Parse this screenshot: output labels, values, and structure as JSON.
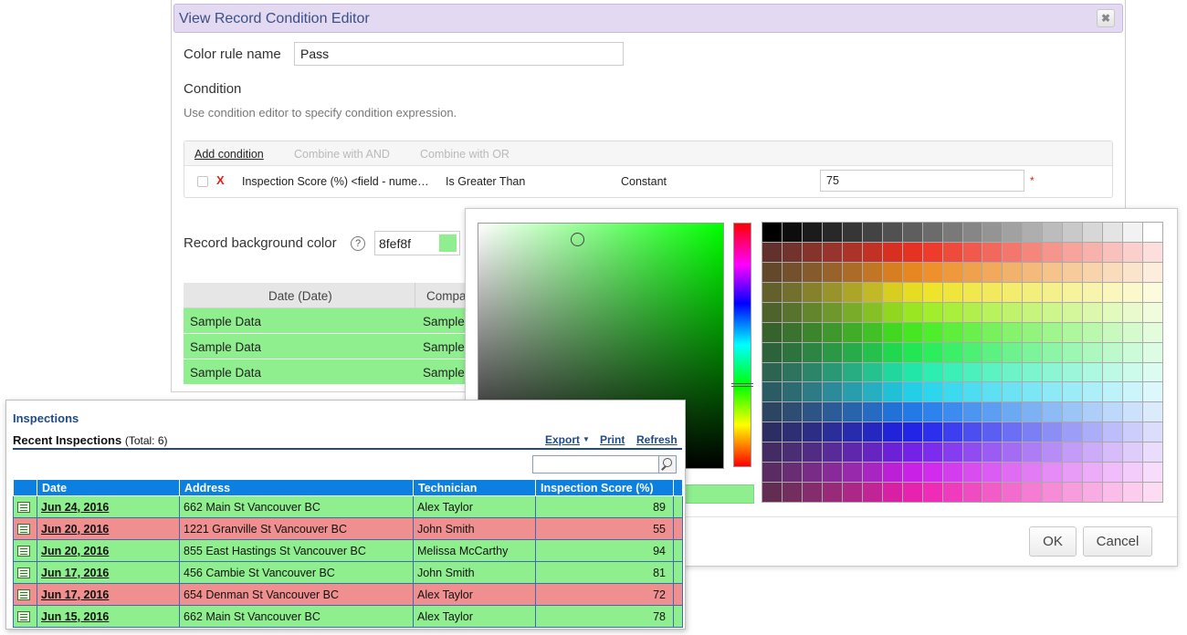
{
  "editor": {
    "title": "View Record Condition Editor",
    "close_label": "✖",
    "rule_name_label": "Color rule name",
    "rule_name_value": "Pass",
    "condition_heading": "Condition",
    "condition_help": "Use condition editor to specify condition expression.",
    "toolbar": {
      "add_condition": "Add condition",
      "combine_and": "Combine with AND",
      "combine_or": "Combine with OR"
    },
    "condition_row": {
      "delete_label": "X",
      "field": "Inspection Score (%) <field - nume…",
      "operator": "Is Greater Than",
      "value_type": "Constant",
      "value": "75",
      "required_mark": "*"
    },
    "background_label": "Record background color",
    "help_label": "?",
    "background_value": "8fef8f",
    "background_color": "#8fef8f",
    "preview": {
      "headers": [
        "Date (Date)",
        "Compa"
      ],
      "rows": [
        [
          "Sample Data",
          "Sample"
        ],
        [
          "Sample Data",
          "Sample"
        ],
        [
          "Sample Data",
          "Sample"
        ]
      ]
    }
  },
  "color_picker": {
    "selected_hue_color": "#00ff00",
    "ok_label": "OK",
    "cancel_label": "Cancel"
  },
  "inspections": {
    "title": "Inspections",
    "subtitle": "Recent Inspections",
    "total": "(Total: 6)",
    "export_label": "Export",
    "print_label": "Print",
    "refresh_label": "Refresh",
    "search_value": "",
    "columns": [
      "Date",
      "Address",
      "Technician",
      "Inspection Score (%)"
    ],
    "pass_color": "#8fef8f",
    "fail_color": "#ef8f8f",
    "rows": [
      {
        "date": "Jun 24, 2016",
        "address": "662 Main St Vancouver BC",
        "technician": "Alex Taylor",
        "score": "89",
        "status": "pass"
      },
      {
        "date": "Jun 20, 2016",
        "address": "1221 Granville St Vancouver BC",
        "technician": "John Smith",
        "score": "55",
        "status": "fail"
      },
      {
        "date": "Jun 20, 2016",
        "address": "855 East Hastings St Vancouver BC",
        "technician": "Melissa McCarthy",
        "score": "94",
        "status": "pass"
      },
      {
        "date": "Jun 17, 2016",
        "address": "456 Cambie St Vancouver BC",
        "technician": "John Smith",
        "score": "81",
        "status": "pass"
      },
      {
        "date": "Jun 17, 2016",
        "address": "654 Denman St Vancouver BC",
        "technician": "Alex Taylor",
        "score": "72",
        "status": "fail"
      },
      {
        "date": "Jun 15, 2016",
        "address": "662 Main St Vancouver BC",
        "technician": "Alex Taylor",
        "score": "78",
        "status": "pass"
      }
    ]
  }
}
